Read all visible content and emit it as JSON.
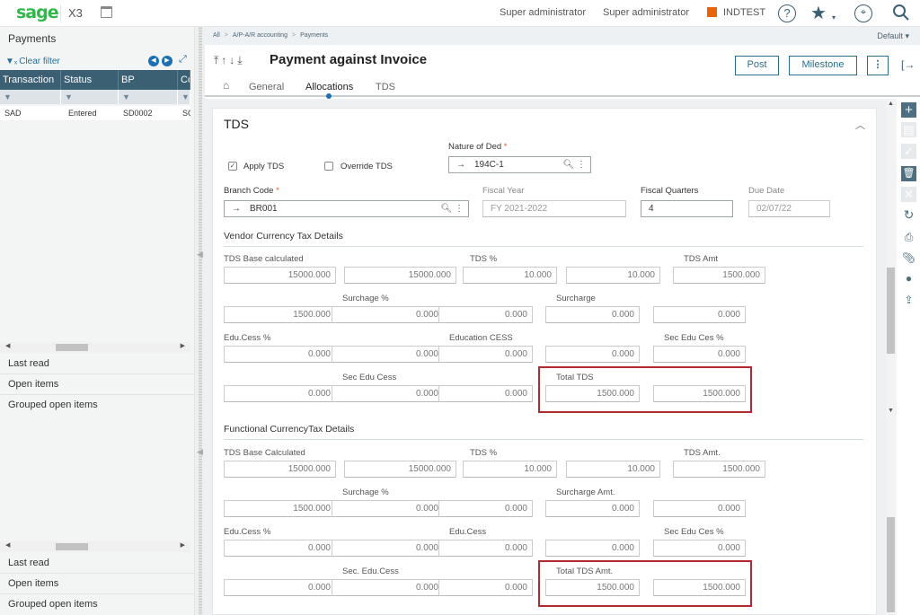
{
  "topbar": {
    "brand": "sage",
    "product": "X3",
    "user1": "Super administrator",
    "user2": "Super administrator",
    "site": "INDTEST",
    "site_color": "#e8630a",
    "icons": {
      "calendar": "calendar-icon",
      "help": "?",
      "star": "★",
      "star_dd": "▾",
      "compass": "⌖",
      "search": "⚲"
    }
  },
  "left_panel": {
    "title": "Payments",
    "clear_filter": "Clear filter",
    "grid": {
      "columns": [
        "Transaction",
        "Status",
        "BP",
        "Co"
      ],
      "rows": [
        [
          "SAD",
          "Entered",
          "SD0002",
          "SC"
        ]
      ]
    },
    "links_top": [
      "Last read",
      "Open items",
      "Grouped open items"
    ],
    "links_bottom": [
      "Last read",
      "Open items",
      "Grouped open items"
    ]
  },
  "breadcrumb": {
    "items": [
      "All",
      "A/P-A/R accounting",
      "Payments"
    ],
    "sep": ">"
  },
  "view_selector": "Default",
  "header": {
    "arrows": "⤒↑↓⤓",
    "title": "Payment against Invoice",
    "tabs": [
      "General",
      "Allocations",
      "TDS"
    ],
    "active_tab": "Allocations",
    "buttons": {
      "post": "Post",
      "milestone": "Milestone",
      "more": "⋮"
    }
  },
  "tds": {
    "section_title": "TDS",
    "apply_tds": {
      "label": "Apply TDS",
      "checked": true
    },
    "override_tds": {
      "label": "Override TDS",
      "checked": false
    },
    "nature_of_ded": {
      "label": "Nature of Ded",
      "value": "194C-1"
    },
    "branch_code": {
      "label": "Branch Code",
      "value": "BR001"
    },
    "fiscal_year": {
      "label": "Fiscal Year",
      "value": "FY 2021-2022"
    },
    "fiscal_quarters": {
      "label": "Fiscal Quarters",
      "value": "4"
    },
    "due_date": {
      "label": "Due Date",
      "value": "02/07/22"
    },
    "vendor": {
      "title": "Vendor Currency Tax Details",
      "labels": {
        "base": "TDS Base calculated",
        "pct": "TDS %",
        "amt": "TDS Amt",
        "sur_pct": "Surchage %",
        "sur": "Surcharge",
        "edu_pct": "Edu.Cess %",
        "edu": "Education CESS",
        "sec_pct": "Sec Edu Ces %",
        "sec": "Sec Edu Cess",
        "total": "Total TDS"
      },
      "rows": [
        [
          "15000.000",
          "15000.000",
          "10.000",
          "10.000",
          "1500.000"
        ],
        [
          "1500.000",
          "0.000",
          "0.000",
          "0.000",
          "0.000"
        ],
        [
          "0.000",
          "0.000",
          "0.000",
          "0.000",
          "0.000"
        ],
        [
          "0.000",
          "0.000",
          "0.000",
          "1500.000",
          "1500.000"
        ]
      ]
    },
    "functional": {
      "title": "Functional CurrencyTax Details",
      "labels": {
        "base": "TDS Base Calculated",
        "pct": "TDS %",
        "amt": "TDS Amt.",
        "sur_pct": "Surchage %",
        "sur": "Surcharge Amt.",
        "edu_pct": "Edu.Cess %",
        "edu": "Edu.Cess",
        "sec_pct": "Sec Edu Ces %",
        "sec": "Sec. Edu.Cess",
        "total": "Total TDS Amt."
      },
      "rows": [
        [
          "15000.000",
          "15000.000",
          "10.000",
          "10.000",
          "1500.000"
        ],
        [
          "1500.000",
          "0.000",
          "0.000",
          "0.000",
          "0.000"
        ],
        [
          "0.000",
          "0.000",
          "0.000",
          "0.000",
          "0.000"
        ],
        [
          "0.000",
          "0.000",
          "0.000",
          "1500.000",
          "1500.000"
        ]
      ]
    }
  },
  "right_toolbar": [
    "add",
    "save",
    "validate",
    "delete",
    "cancel",
    "refresh",
    "print",
    "attach",
    "comment",
    "export"
  ]
}
